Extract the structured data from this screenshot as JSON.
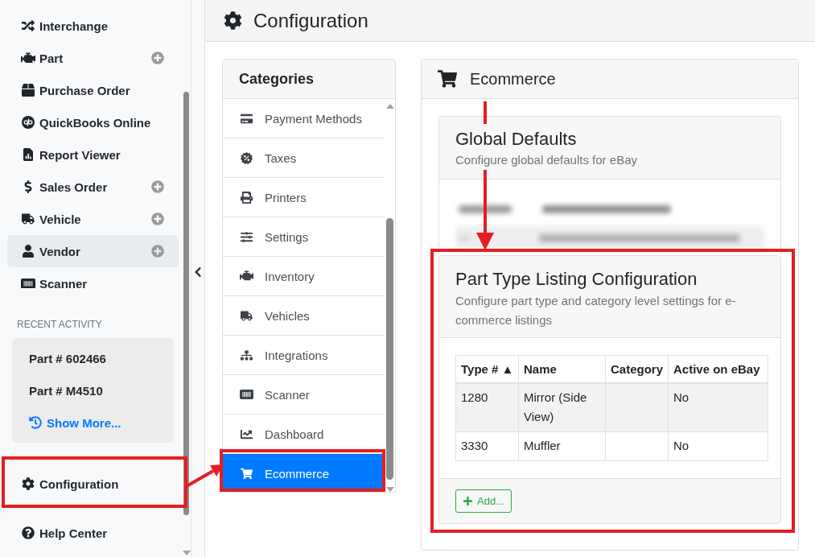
{
  "sidebar": {
    "nav_items": [
      {
        "label": "Interchange",
        "has_add": false,
        "highlighted": false
      },
      {
        "label": "Part",
        "has_add": true,
        "highlighted": false
      },
      {
        "label": "Purchase Order",
        "has_add": false,
        "highlighted": false
      },
      {
        "label": "QuickBooks Online",
        "has_add": false,
        "highlighted": false
      },
      {
        "label": "Report Viewer",
        "has_add": false,
        "highlighted": false
      },
      {
        "label": "Sales Order",
        "has_add": true,
        "highlighted": false
      },
      {
        "label": "Vehicle",
        "has_add": true,
        "highlighted": false
      },
      {
        "label": "Vendor",
        "has_add": true,
        "highlighted": true
      },
      {
        "label": "Scanner",
        "has_add": false,
        "highlighted": false
      }
    ],
    "recent_activity": {
      "heading": "RECENT ACTIVITY",
      "items": [
        "Part # 602466",
        "Part # M4510"
      ],
      "show_more": "Show More..."
    },
    "footer_items": [
      {
        "label": "Configuration"
      },
      {
        "label": "Help Center"
      }
    ]
  },
  "page_header": {
    "title": "Configuration"
  },
  "categories": {
    "title": "Categories",
    "items": [
      {
        "label": "Payment Methods",
        "selected": false
      },
      {
        "label": "Taxes",
        "selected": false
      },
      {
        "label": "Printers",
        "selected": false
      },
      {
        "label": "Settings",
        "selected": false
      },
      {
        "label": "Inventory",
        "selected": false
      },
      {
        "label": "Vehicles",
        "selected": false
      },
      {
        "label": "Integrations",
        "selected": false
      },
      {
        "label": "Scanner",
        "selected": false
      },
      {
        "label": "Dashboard",
        "selected": false
      },
      {
        "label": "Ecommerce",
        "selected": true
      }
    ]
  },
  "ecommerce_panel": {
    "title": "Ecommerce",
    "global_defaults": {
      "title": "Global Defaults",
      "subtitle": "Configure global defaults for eBay"
    },
    "part_type_listing": {
      "title": "Part Type Listing Configuration",
      "subtitle": "Configure part type and category level settings for e-commerce listings",
      "table": {
        "columns": [
          {
            "label": "Type #",
            "sort_mark": "▲"
          },
          {
            "label": "Name"
          },
          {
            "label": "Category"
          },
          {
            "label": "Active on eBay"
          }
        ],
        "rows": [
          {
            "type_no": "1280",
            "name": "Mirror (Side View)",
            "active_on_ebay": "No"
          },
          {
            "type_no": "3330",
            "name": "Muffler",
            "active_on_ebay": "No"
          }
        ]
      },
      "add_button": "Add..."
    }
  }
}
